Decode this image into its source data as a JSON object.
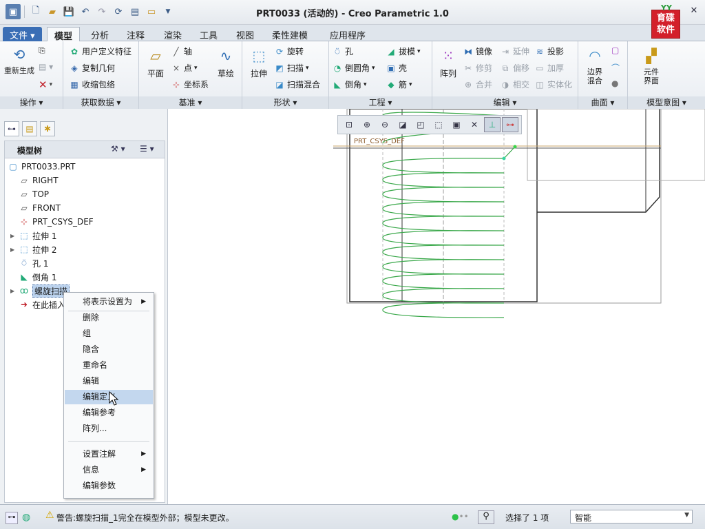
{
  "window": {
    "title": "PRT0033 (活动的) - Creo Parametric 1.0"
  },
  "logo": {
    "line1": "育碟",
    "line2": "软件",
    "tag": "YY"
  },
  "tabs": [
    "文件",
    "模型",
    "分析",
    "注释",
    "渲染",
    "工具",
    "视图",
    "柔性建模",
    "应用程序"
  ],
  "ribbon": {
    "groups": {
      "operation": "操作",
      "get_data": "获取数据",
      "datum": "基准",
      "shape": "形状",
      "engineering": "工程",
      "edit": "编辑",
      "surface": "曲面",
      "model_intent": "模型意图"
    },
    "regen_label": "重新生成",
    "udf": "用户定义特征",
    "copy_geom": "复制几何",
    "shrinkwrap": "收缩包络",
    "plane": "平面",
    "axis": "轴",
    "point": "点",
    "csys": "坐标系",
    "sketch": "草绘",
    "extrude": "拉伸",
    "revolve": "旋转",
    "sweep": "扫描",
    "swept_blend": "扫描混合",
    "hole": "孔",
    "round": "倒圆角",
    "chamfer": "倒角",
    "draft": "拔模",
    "shell": "壳",
    "rib": "筋",
    "pattern": "阵列",
    "mirror": "镜像",
    "trim": "修剪",
    "merge": "合并",
    "extend": "延伸",
    "offset": "偏移",
    "intersect": "相交",
    "project": "投影",
    "thicken": "加厚",
    "solidify": "实体化",
    "boundary_blend": "边界混合",
    "component_interface": "元件界面"
  },
  "tree": {
    "header": "模型树",
    "items": [
      {
        "label": "PRT0033.PRT"
      },
      {
        "label": "RIGHT"
      },
      {
        "label": "TOP"
      },
      {
        "label": "FRONT"
      },
      {
        "label": "PRT_CSYS_DEF"
      },
      {
        "label": "拉伸 1"
      },
      {
        "label": "拉伸 2"
      },
      {
        "label": "孔 1"
      },
      {
        "label": "倒角 1"
      },
      {
        "label": "螺旋扫描"
      },
      {
        "label": "在此插入"
      }
    ]
  },
  "context_menu": {
    "items": [
      "将表示设置为",
      "删除",
      "组",
      "隐含",
      "重命名",
      "编辑",
      "编辑定义",
      "编辑参考",
      "阵列...",
      "设置注解",
      "信息",
      "编辑参数"
    ]
  },
  "graphics": {
    "csys_label": "PRT_CSYS_DEF"
  },
  "status": {
    "message": "警告:螺旋扫描_1完全在模型外部；模型未更改。",
    "selection": "选择了 1 项",
    "filter": "智能"
  }
}
